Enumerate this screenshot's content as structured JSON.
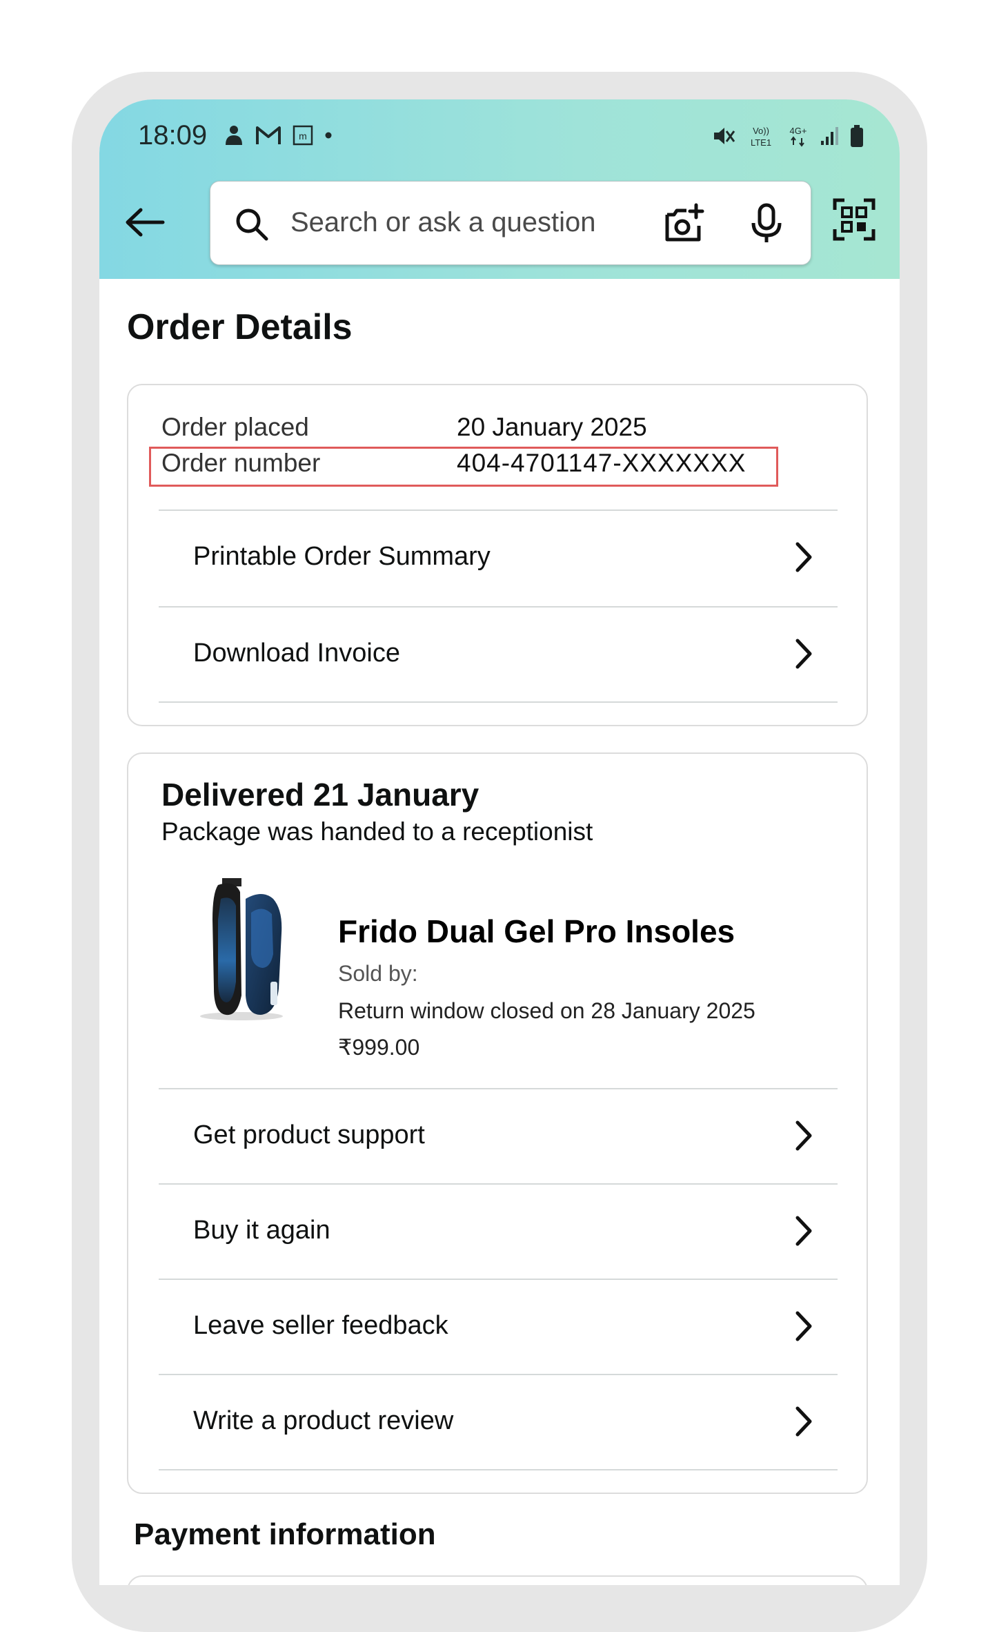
{
  "status_bar": {
    "time": "18:09",
    "network_label_top": "Vo))",
    "network_label_bottom": "LTE1",
    "network_type": "4G+"
  },
  "search": {
    "placeholder": "Search or ask a question"
  },
  "page": {
    "title": "Order Details"
  },
  "order_info": {
    "placed_label": "Order placed",
    "placed_value": "20 January 2025",
    "number_label": "Order number",
    "number_value": "404-4701147-XXXXXXX",
    "highlight_color": "#e05a5a"
  },
  "order_actions": [
    {
      "label": "Printable Order Summary"
    },
    {
      "label": "Download Invoice"
    }
  ],
  "delivery": {
    "title": "Delivered 21 January",
    "subtitle": "Package was handed to a receptionist"
  },
  "product": {
    "name": "Frido Dual Gel Pro Insoles",
    "sold_by": "Sold by:",
    "return_window": "Return window closed on 28 January 2025",
    "price": "₹999.00"
  },
  "item_actions": [
    {
      "label": "Get product support"
    },
    {
      "label": "Buy it again"
    },
    {
      "label": "Leave seller feedback"
    },
    {
      "label": "Write a product review"
    }
  ],
  "payment": {
    "title": "Payment information"
  },
  "colors": {
    "header_gradient_start": "#84d8e3",
    "header_gradient_end": "#a6e6d2",
    "frame": "#e6e6e6"
  }
}
